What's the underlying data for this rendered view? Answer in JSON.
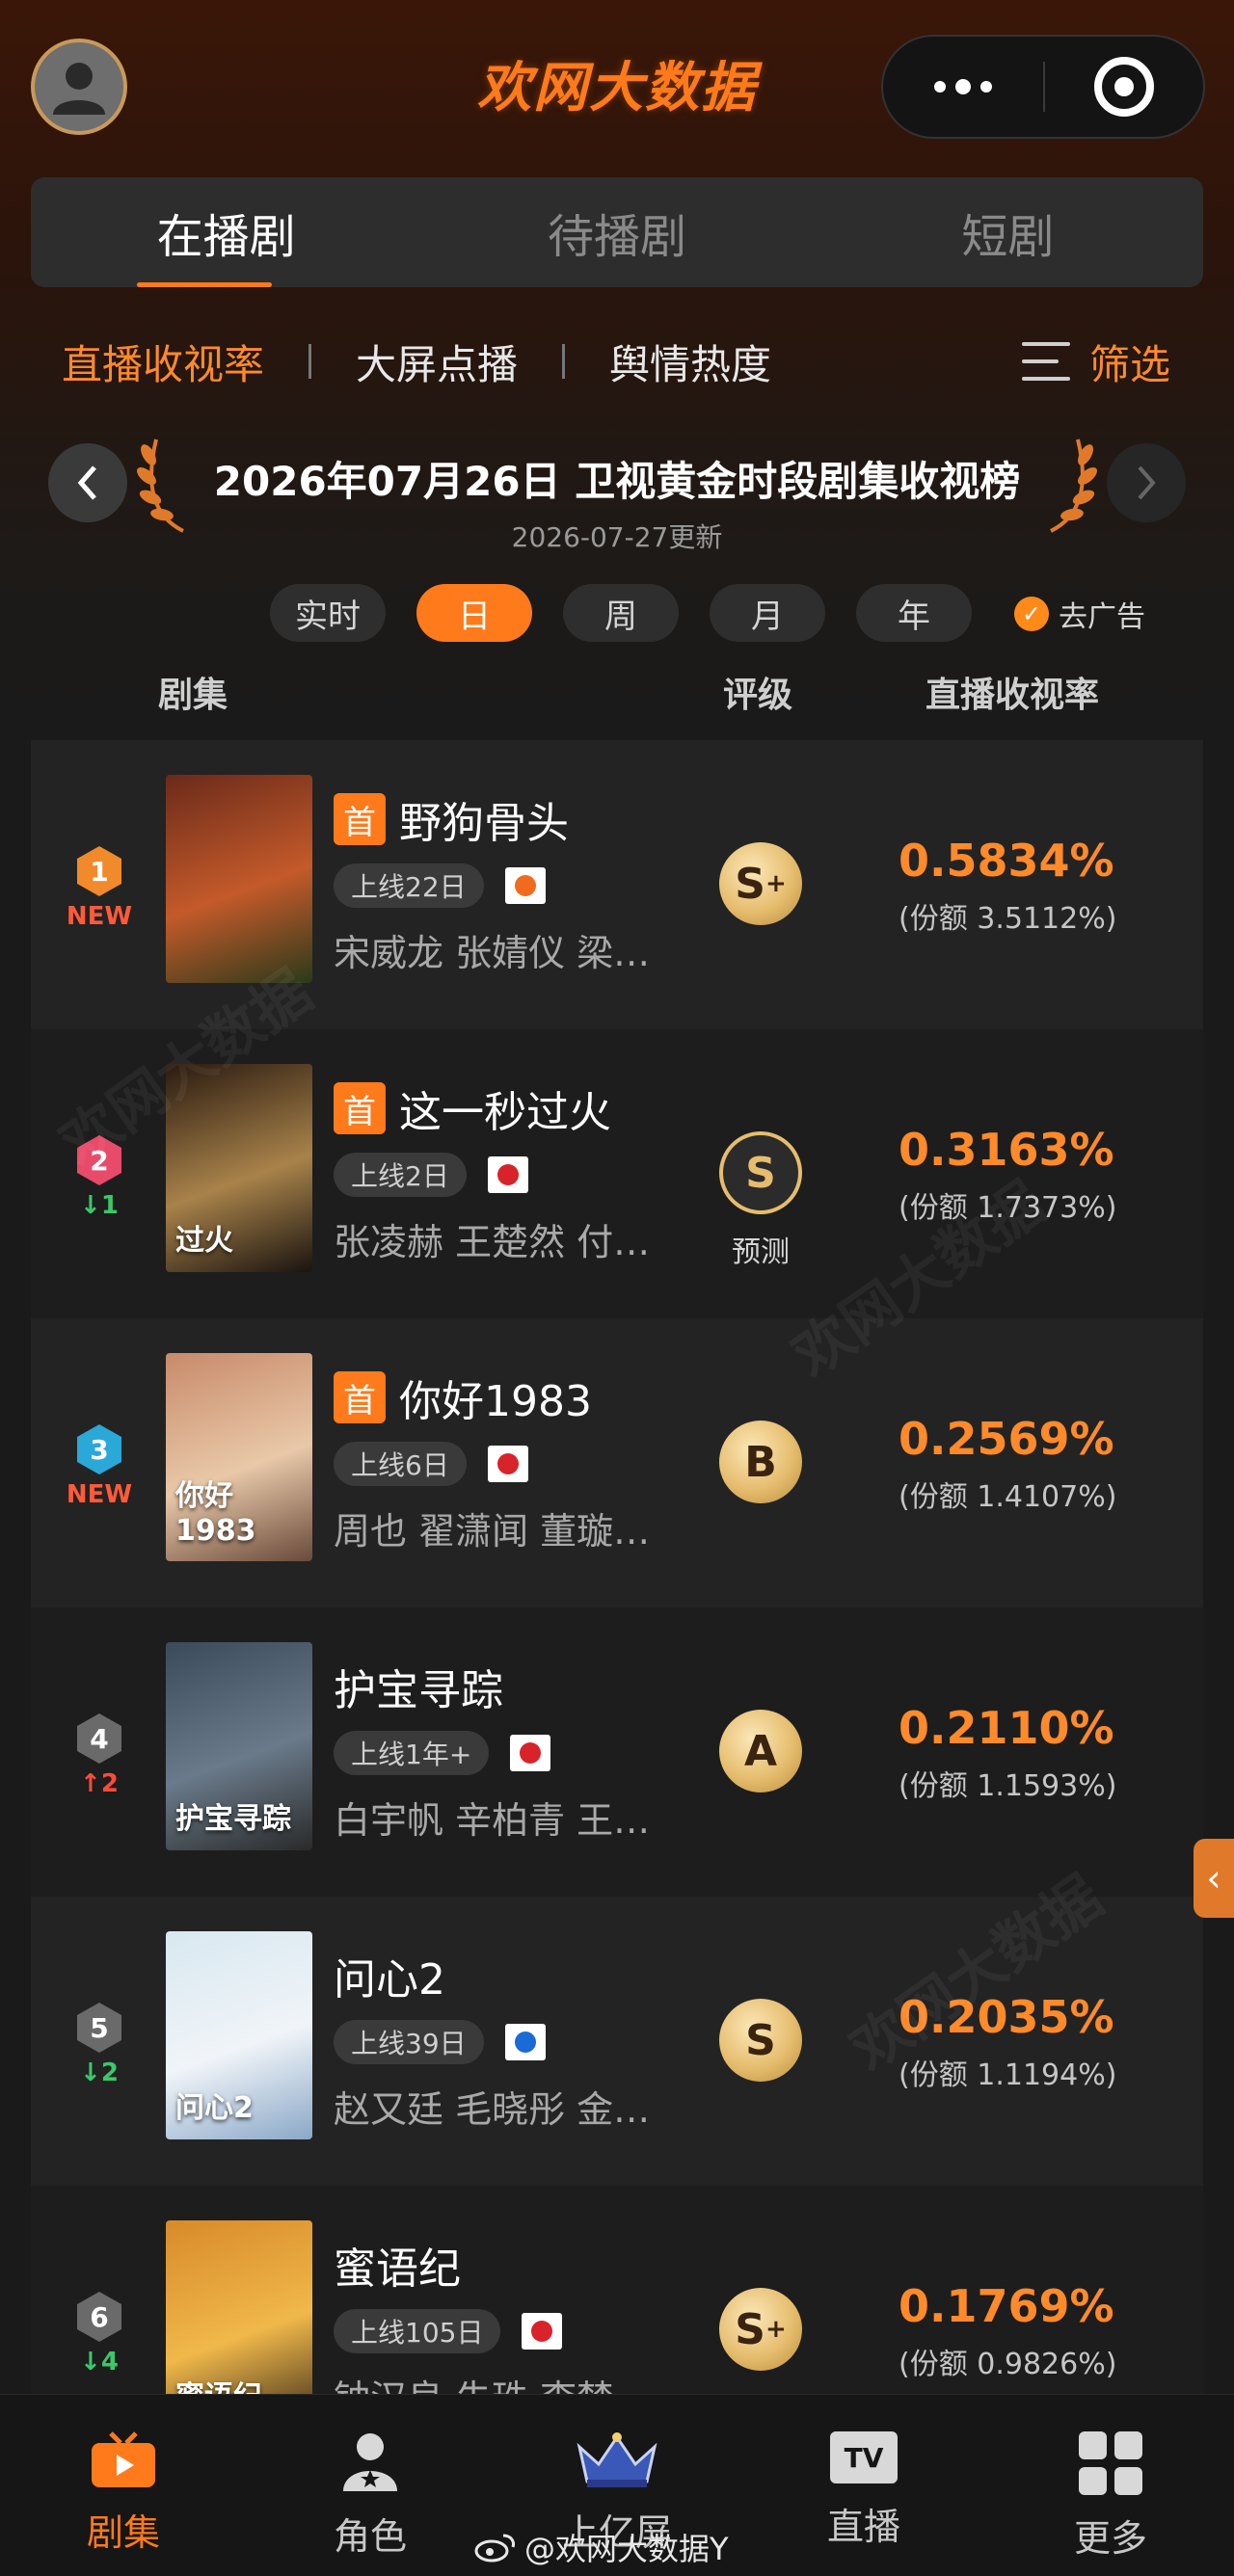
{
  "header": {
    "logo_text": "欢网大数据",
    "brand_color": "#ff7a1a"
  },
  "main_tabs": [
    {
      "label": "在播剧",
      "active": true
    },
    {
      "label": "待播剧",
      "active": false
    },
    {
      "label": "短剧",
      "active": false
    }
  ],
  "sub_tabs": [
    {
      "label": "直播收视率",
      "active": true
    },
    {
      "label": "大屏点播",
      "active": false
    },
    {
      "label": "舆情热度",
      "active": false
    }
  ],
  "filter_label": "筛选",
  "ranking": {
    "title": "2026年07月26日 卫视黄金时段剧集收视榜",
    "update_time": "2026-07-27更新"
  },
  "periods": [
    {
      "label": "实时",
      "active": false
    },
    {
      "label": "日",
      "active": true
    },
    {
      "label": "周",
      "active": false
    },
    {
      "label": "月",
      "active": false
    },
    {
      "label": "年",
      "active": false
    }
  ],
  "no_ads_label": "去广告",
  "columns": {
    "show": "剧集",
    "grade": "评级",
    "rating": "直播收视率"
  },
  "shows": [
    {
      "rank": "1",
      "change": "NEW",
      "change_dir": "new",
      "badge_color": "#f08a2a",
      "first": "首",
      "name": "野狗骨头",
      "online": "上线22日",
      "channel_icon": "hunan-tv-icon",
      "channel_color": "#f26a1b",
      "cast": "宋威龙 张婧仪 梁…",
      "grade": "S",
      "grade_plus": "+",
      "outlined": false,
      "predict": "",
      "rating": "0.5834%",
      "share": "(份额 3.5112%)",
      "poster_colors": [
        "#6a2a1a",
        "#c45a2a",
        "#2a3a1a"
      ],
      "poster_text": ""
    },
    {
      "rank": "2",
      "change": "1",
      "change_dir": "down",
      "badge_color": "#e84a6a",
      "first": "首",
      "name": "这一秒过火",
      "online": "上线2日",
      "channel_icon": "dragon-tv-icon",
      "channel_color": "#d8232a",
      "cast": "张凌赫 王楚然 付…",
      "grade": "S",
      "grade_plus": "",
      "outlined": true,
      "predict": "预测",
      "rating": "0.3163%",
      "share": "(份额 1.7373%)",
      "poster_colors": [
        "#2a1a10",
        "#a8824a",
        "#1a1410"
      ],
      "poster_text": "过火"
    },
    {
      "rank": "3",
      "change": "NEW",
      "change_dir": "new",
      "badge_color": "#2aa8d8",
      "first": "首",
      "name": "你好1983",
      "online": "上线6日",
      "channel_icon": "jiangsu-tv-icon",
      "channel_color": "#d8232a",
      "cast": "周也 翟潇闻 董璇…",
      "grade": "B",
      "grade_plus": "",
      "outlined": false,
      "predict": "",
      "rating": "0.2569%",
      "share": "(份额 1.4107%)",
      "poster_colors": [
        "#c88a6a",
        "#e8c8a8",
        "#6a4a3a"
      ],
      "poster_text": "你好1983"
    },
    {
      "rank": "4",
      "change": "2",
      "change_dir": "up",
      "badge_color": "#6a6a6a",
      "first": "",
      "name": "护宝寻踪",
      "online": "上线1年+",
      "channel_icon": "btv-icon",
      "channel_color": "#d8232a",
      "cast": "白宇帆 辛柏青 王…",
      "grade": "A",
      "grade_plus": "",
      "outlined": false,
      "predict": "",
      "rating": "0.2110%",
      "share": "(份额 1.1593%)",
      "poster_colors": [
        "#3a4a5a",
        "#6a7a8a",
        "#2a2a2a"
      ],
      "poster_text": "护宝寻踪"
    },
    {
      "rank": "5",
      "change": "2",
      "change_dir": "down",
      "badge_color": "#6a6a6a",
      "first": "",
      "name": "问心2",
      "online": "上线39日",
      "channel_icon": "zhejiang-tv-icon",
      "channel_color": "#1a6ad8",
      "cast": "赵又廷 毛晓彤 金…",
      "grade": "S",
      "grade_plus": "",
      "outlined": false,
      "predict": "",
      "rating": "0.2035%",
      "share": "(份额 1.1194%)",
      "poster_colors": [
        "#d8e8f0",
        "#f0f4f8",
        "#8aa8c8"
      ],
      "poster_text": "问心2"
    },
    {
      "rank": "6",
      "change": "4",
      "change_dir": "down",
      "badge_color": "#6a6a6a",
      "first": "",
      "name": "蜜语纪",
      "online": "上线105日",
      "channel_icon": "guangdong-tv-icon",
      "channel_color": "#d8232a",
      "cast": "钟汉良 朱珠 李梦…",
      "grade": "S",
      "grade_plus": "+",
      "outlined": false,
      "predict": "",
      "rating": "0.1769%",
      "share": "(份额 0.9826%)",
      "poster_colors": [
        "#d88a2a",
        "#f0b84a",
        "#3a2a1a"
      ],
      "poster_text": "蜜语纪"
    }
  ],
  "tabbar": [
    {
      "label": "剧集",
      "icon": "tv-play-icon",
      "active": true
    },
    {
      "label": "角色",
      "icon": "person-star-icon",
      "active": false
    },
    {
      "label": "上亿屏",
      "icon": "crown-icon",
      "active": false
    },
    {
      "label": "直播",
      "icon": "tv-live-icon",
      "active": false
    },
    {
      "label": "更多",
      "icon": "grid-more-icon",
      "active": false
    }
  ],
  "tv_icon_text": "TV",
  "weibo_watermark": "@欢网大数据Y"
}
